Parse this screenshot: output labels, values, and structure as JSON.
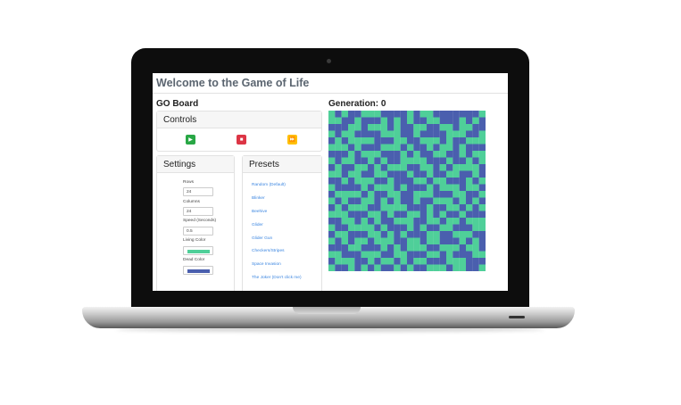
{
  "app": {
    "title": "Welcome to the Game of Life",
    "board_title": "GO Board",
    "generation_label": "Generation: 0"
  },
  "controls": {
    "header": "Controls",
    "play_icon": "play-icon",
    "stop_icon": "stop-icon",
    "fast_forward_icon": "fast-forward-icon"
  },
  "settings": {
    "header": "Settings",
    "rows_label": "Rows",
    "rows_value": "24",
    "columns_label": "Columns",
    "columns_value": "24",
    "speed_label": "Speed (Seconds)",
    "speed_value": "0.5",
    "living_color_label": "Living Color",
    "living_color": "#4fcf99",
    "dead_color_label": "Dead Color",
    "dead_color": "#4a5fae"
  },
  "presets": {
    "header": "Presets",
    "items": [
      "Random (Default)",
      "Blinker",
      "Beehive",
      "Glider",
      "Glider Gun",
      "Checkers/Stripes",
      "Space Invasion",
      "The Joker (Don't click me)"
    ]
  },
  "board": {
    "rows": 24,
    "cols": 24,
    "cells": [
      "101001110000101100000001",
      "110010001010100110001010",
      "000110111010011001101100",
      "101100001110010000111001",
      "010111100011001110100111",
      "111010001110100101101000",
      "000101110001010011001011",
      "101100101001111000100101",
      "010011010111001101011110",
      "110110011000100100110010",
      "001011100100011011000101",
      "100001011101000101110110",
      "011110100110011100011001",
      "101001101010010011101010",
      "010111001111000100110101",
      "111000110100110101001000",
      "001101010011100110110111",
      "100111101000101001100011",
      "011000110101000110011100",
      "101011011100110110001010",
      "000110001010111001110110",
      "110001110011000110100011",
      "011100101101011000111000",
      "100101010010100111011001"
    ]
  }
}
